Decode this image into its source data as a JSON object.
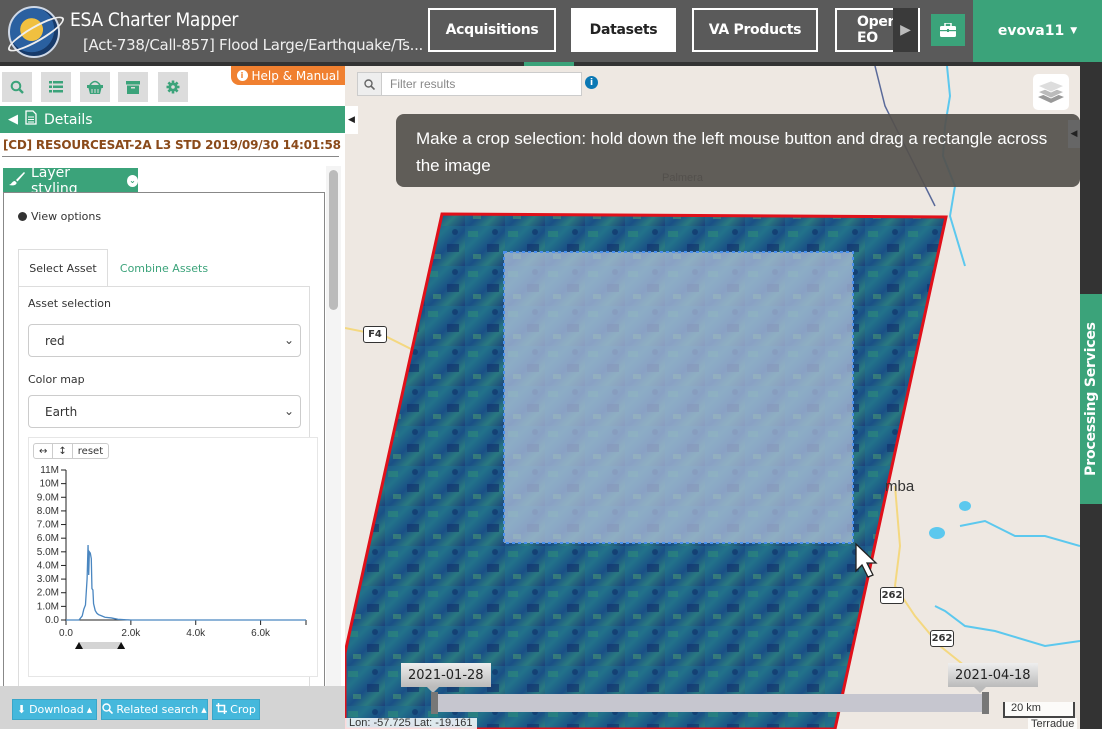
{
  "header": {
    "app_title": "ESA Charter Mapper",
    "subtitle": "[Act-738/Call-857] Flood Large/Earthquake/Ts...",
    "nav": [
      {
        "label": "Acquisitions",
        "active": false
      },
      {
        "label": "Datasets",
        "active": true
      },
      {
        "label": "VA Products",
        "active": false
      },
      {
        "label": "Open EO",
        "active": false
      }
    ],
    "user": "evova11"
  },
  "left_panel": {
    "toolbar_icons": [
      "search-icon",
      "list-icon",
      "basket-icon",
      "archive-icon",
      "gear-icon"
    ],
    "help_label": "Help & Manual",
    "details_label": "Details",
    "dataset_title": "[CD] RESOURCESAT-2A L3 STD 2019/09/30 14:01:58",
    "styling_label": "Layer styling",
    "view_options": "View options",
    "tabs": [
      {
        "label": "Select Asset",
        "active": true
      },
      {
        "label": "Combine Assets",
        "active": false
      }
    ],
    "asset_selection_label": "Asset selection",
    "asset_selection_value": "red",
    "color_map_label": "Color map",
    "color_map_value": "Earth",
    "histogram_buttons": [
      "↔",
      "↕",
      "reset"
    ],
    "actions": [
      {
        "label": "Download",
        "icon": "download-icon"
      },
      {
        "label": "Related search",
        "icon": "search-icon"
      },
      {
        "label": "Crop",
        "icon": "crop-icon"
      }
    ]
  },
  "histogram": {
    "type": "line",
    "y_ticks": [
      "0.0",
      "1.0M",
      "2.0M",
      "3.0M",
      "4.0M",
      "5.0M",
      "6.0M",
      "7.0M",
      "8.0M",
      "9.0M",
      "10M",
      "11M"
    ],
    "x_ticks": [
      "0.0",
      "2.0k",
      "4.0k",
      "6.0k"
    ],
    "xlim": [
      0,
      7400
    ],
    "ylim": [
      0,
      11000000
    ],
    "range_selection": [
      400,
      1700
    ]
  },
  "chart_data": {
    "type": "line",
    "title": "",
    "xlabel": "",
    "ylabel": "",
    "xlim": [
      0,
      7400
    ],
    "ylim": [
      0,
      11000000
    ],
    "x": [
      0,
      400,
      500,
      550,
      600,
      650,
      680,
      700,
      720,
      750,
      780,
      800,
      830,
      850,
      900,
      950,
      1000,
      1100,
      1200,
      1400,
      1600,
      2000,
      3000,
      5000,
      7400
    ],
    "values": [
      0,
      0,
      300000,
      800000,
      1100000,
      3000000,
      5500000,
      3300000,
      5000000,
      4900000,
      4500000,
      2300000,
      2200000,
      1200000,
      700000,
      500000,
      400000,
      300000,
      200000,
      150000,
      50000,
      0,
      0,
      0,
      0
    ],
    "x_ticks": [
      "0.0",
      "2.0k",
      "4.0k",
      "6.0k"
    ],
    "y_ticks": [
      "0.0",
      "1.0M",
      "2.0M",
      "3.0M",
      "4.0M",
      "5.0M",
      "6.0M",
      "7.0M",
      "8.0M",
      "9.0M",
      "10M",
      "11M"
    ]
  },
  "map": {
    "filter_placeholder": "Filter results",
    "tooltip": "Make a crop selection: hold down the left mouse button and drag a rectangle across the image",
    "places": [
      "Palmera",
      "mba"
    ],
    "road_shields": [
      "F4",
      "262",
      "262"
    ],
    "timeline_start": "2021-01-28",
    "timeline_end": "2021-04-18",
    "scale": "20 km",
    "attribution": "Terradue",
    "coords": "Lon: -57.725 Lat: -19.161",
    "processing_tab": "Processing Services"
  }
}
